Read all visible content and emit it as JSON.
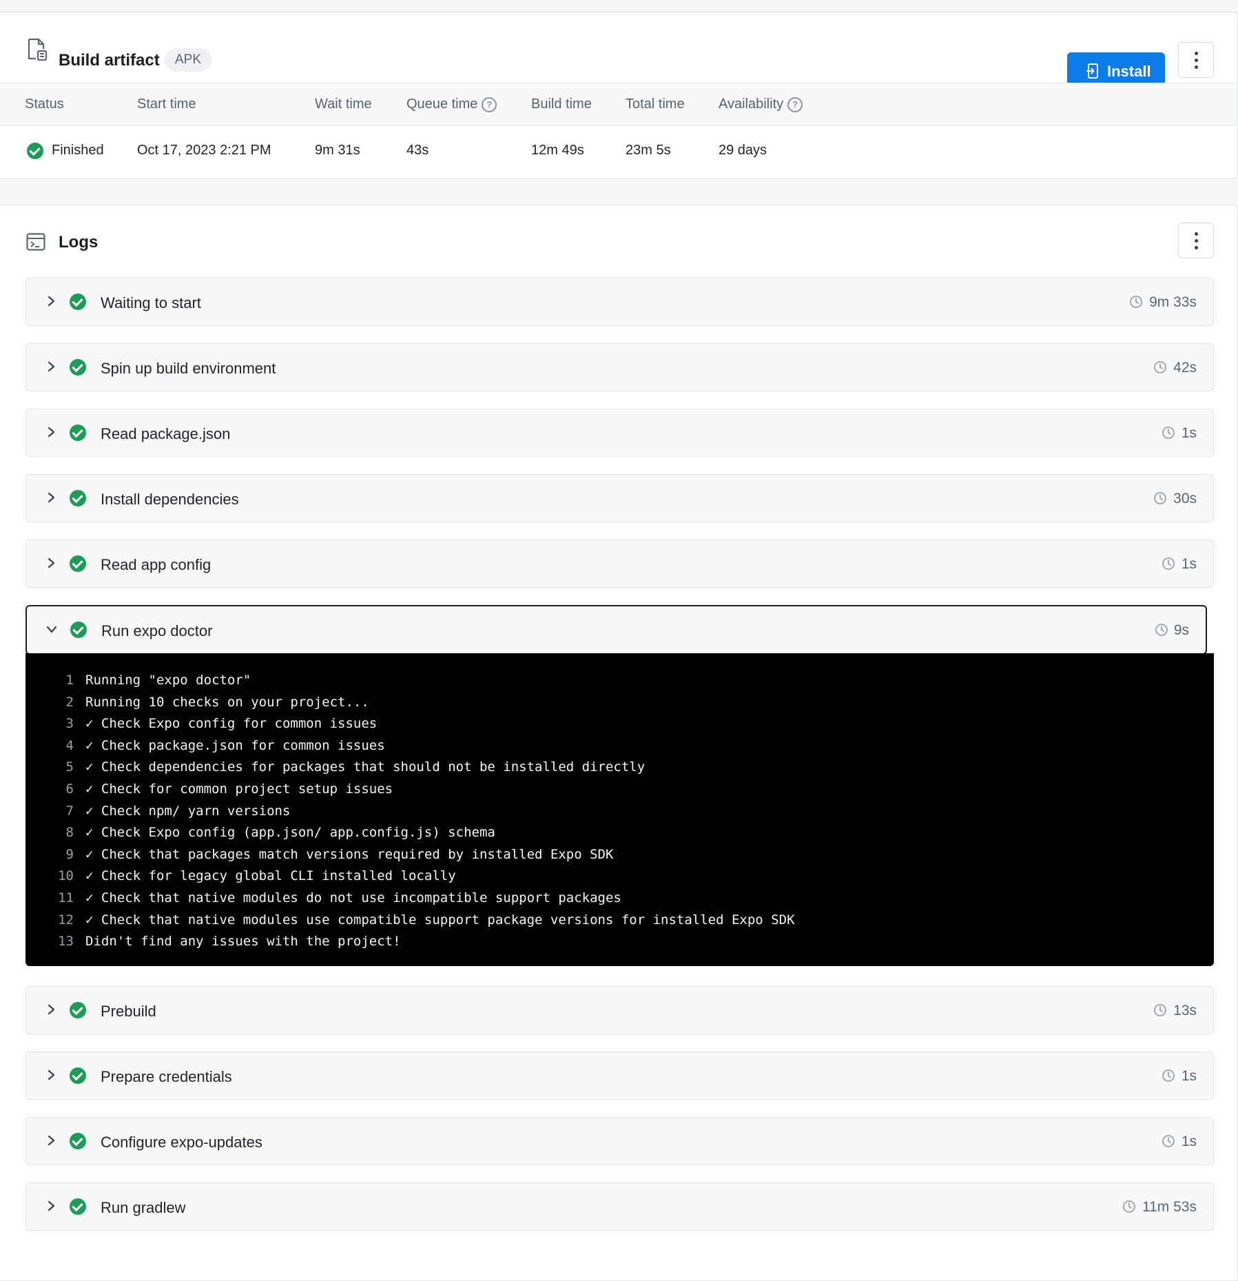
{
  "artifact": {
    "title": "Build artifact",
    "badge": "APK",
    "install_label": "Install",
    "columns": {
      "status": "Status",
      "start_time": "Start time",
      "wait_time": "Wait time",
      "queue_time": "Queue time",
      "build_time": "Build time",
      "total_time": "Total time",
      "availability": "Availability"
    },
    "values": {
      "status": "Finished",
      "start_time": "Oct 17, 2023 2:21 PM",
      "wait_time": "9m 31s",
      "queue_time": "43s",
      "build_time": "12m 49s",
      "total_time": "23m 5s",
      "availability": "29 days"
    }
  },
  "logs": {
    "title": "Logs",
    "steps": [
      {
        "label": "Waiting to start",
        "duration": "9m 33s"
      },
      {
        "label": "Spin up build environment",
        "duration": "42s"
      },
      {
        "label": "Read package.json",
        "duration": "1s"
      },
      {
        "label": "Install dependencies",
        "duration": "30s"
      },
      {
        "label": "Read app config",
        "duration": "1s"
      },
      {
        "label": "Run expo doctor",
        "duration": "9s"
      },
      {
        "label": "Prebuild",
        "duration": "13s"
      },
      {
        "label": "Prepare credentials",
        "duration": "1s"
      },
      {
        "label": "Configure expo-updates",
        "duration": "1s"
      },
      {
        "label": "Run gradlew",
        "duration": "11m 53s"
      }
    ],
    "terminal": [
      {
        "n": "1",
        "text": "Running \"expo doctor\""
      },
      {
        "n": "2",
        "text": "Running 10 checks on your project..."
      },
      {
        "n": "3",
        "text": "✓ Check Expo config for common issues"
      },
      {
        "n": "4",
        "text": "✓ Check package.json for common issues"
      },
      {
        "n": "5",
        "text": "✓ Check dependencies for packages that should not be installed directly"
      },
      {
        "n": "6",
        "text": "✓ Check for common project setup issues"
      },
      {
        "n": "7",
        "text": "✓ Check npm/ yarn versions"
      },
      {
        "n": "8",
        "text": "✓ Check Expo config (app.json/ app.config.js) schema"
      },
      {
        "n": "9",
        "text": "✓ Check that packages match versions required by installed Expo SDK"
      },
      {
        "n": "10",
        "text": "✓ Check for legacy global CLI installed locally"
      },
      {
        "n": "11",
        "text": "✓ Check that native modules do not use incompatible support packages"
      },
      {
        "n": "12",
        "text": "✓ Check that native modules use compatible support package versions for installed Expo SDK"
      },
      {
        "n": "13",
        "text": "Didn't find any issues with the project!"
      }
    ]
  },
  "colors": {
    "accent": "#0b7ce8",
    "success": "#1e9b57",
    "terminal_bg": "#000000"
  },
  "icons": {
    "artifact": "document-icon",
    "install": "install-device-icon",
    "logs": "terminal-icon",
    "more": "kebab-menu-icon",
    "duration": "clock-icon"
  }
}
